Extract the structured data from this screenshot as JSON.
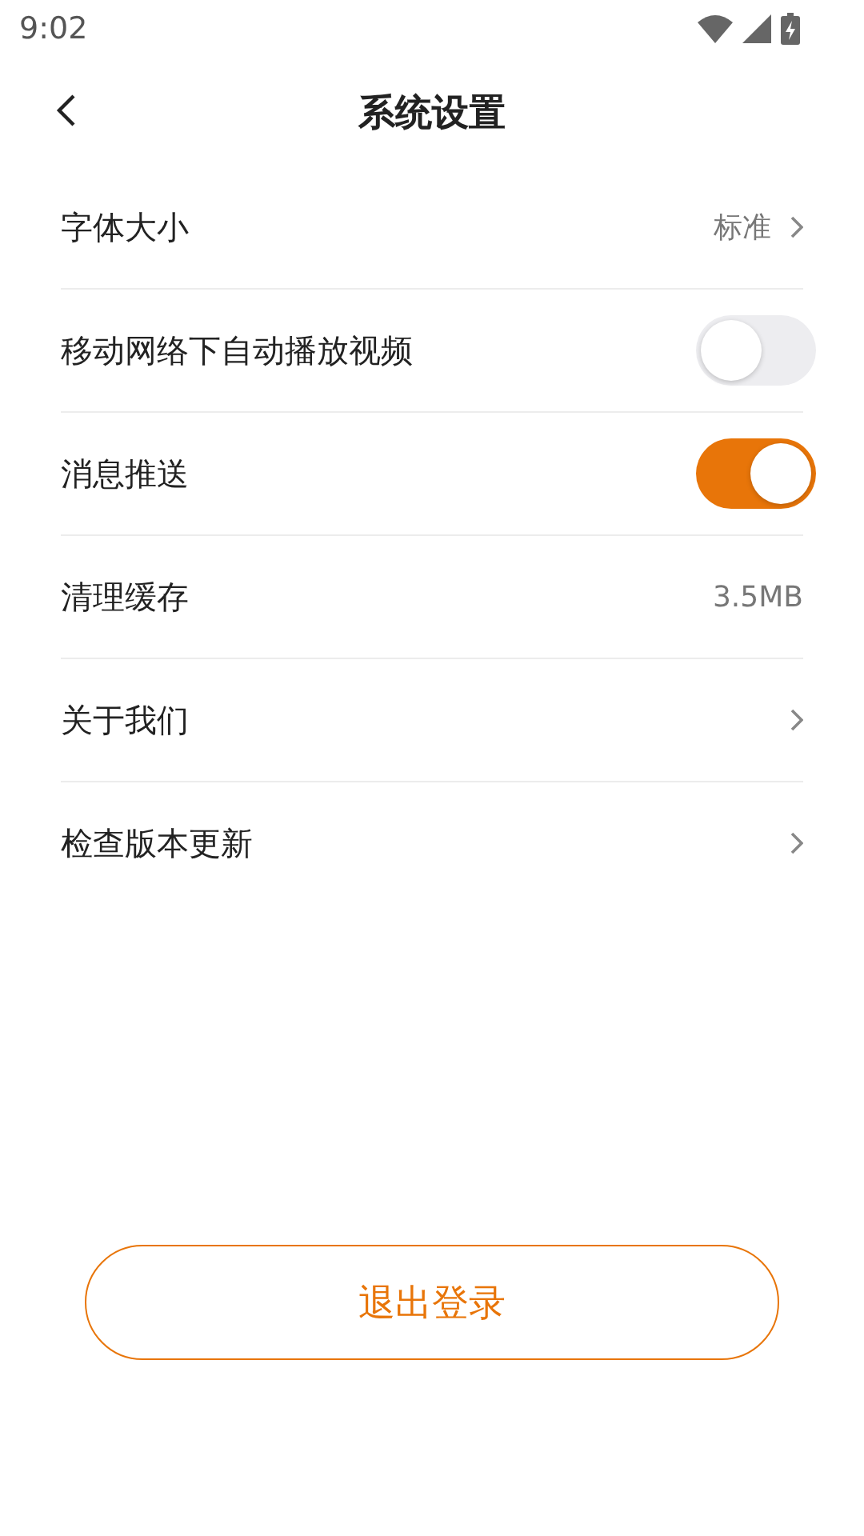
{
  "status_bar": {
    "time": "9:02"
  },
  "header": {
    "title": "系统设置"
  },
  "settings": [
    {
      "kind": "link",
      "label": "字体大小",
      "value": "标准"
    },
    {
      "kind": "toggle",
      "label": "移动网络下自动播放视频",
      "on": false
    },
    {
      "kind": "toggle",
      "label": "消息推送",
      "on": true
    },
    {
      "kind": "value",
      "label": "清理缓存",
      "value": "3.5MB"
    },
    {
      "kind": "link",
      "label": "关于我们"
    },
    {
      "kind": "link",
      "label": "检查版本更新"
    }
  ],
  "logout_button": "退出登录"
}
